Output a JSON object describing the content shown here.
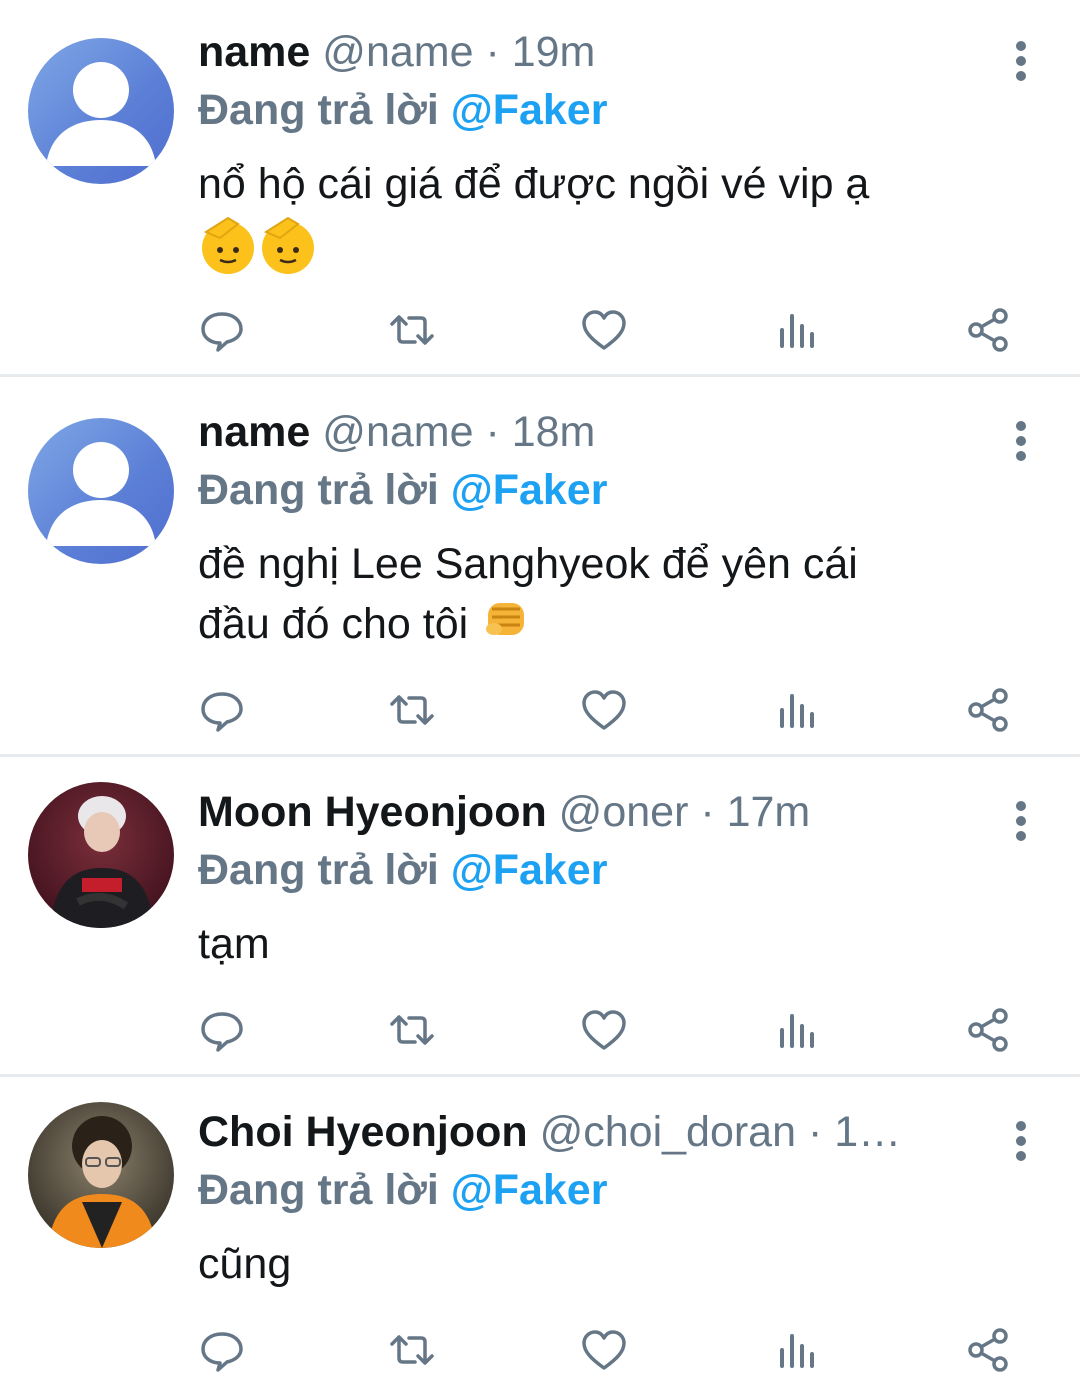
{
  "tweets": [
    {
      "display_name": "name",
      "handle_time": " @name · 19m",
      "reply_prefix": "Đang trả lời ",
      "reply_mention": "@Faker",
      "text": "nổ hộ cái giá để được ngồi vé vip ạ",
      "emoji": "saluting-face emoji x2"
    },
    {
      "display_name": "name",
      "handle_time": " @name · 18m",
      "reply_prefix": "Đang trả lời ",
      "reply_mention": "@Faker",
      "text_line1": "đề nghị Lee Sanghyeok để yên cái",
      "text_line2": "đầu đó cho tôi",
      "emoji": "oncoming-fist emoji"
    },
    {
      "display_name": "Moon Hyeonjoon",
      "handle_time": " @oner · 17m",
      "reply_prefix": "Đang trả lời ",
      "reply_mention": "@Faker",
      "text": "tạm"
    },
    {
      "display_name": "Choi Hyeonjoon",
      "handle_time": " @choi_doran · 1…",
      "reply_prefix": "Đang trả lời ",
      "reply_mention": "@Faker",
      "text": "cũng"
    }
  ],
  "icons": {
    "reply": "comment-icon",
    "retweet": "retweet-icon",
    "like": "heart-icon",
    "analytics": "analytics-icon",
    "share": "share-icon",
    "more": "more-vertical-icon"
  },
  "colors": {
    "text": "#14171a",
    "secondary": "#657786",
    "accent": "#1da1f2",
    "divider": "#e8ebed"
  }
}
